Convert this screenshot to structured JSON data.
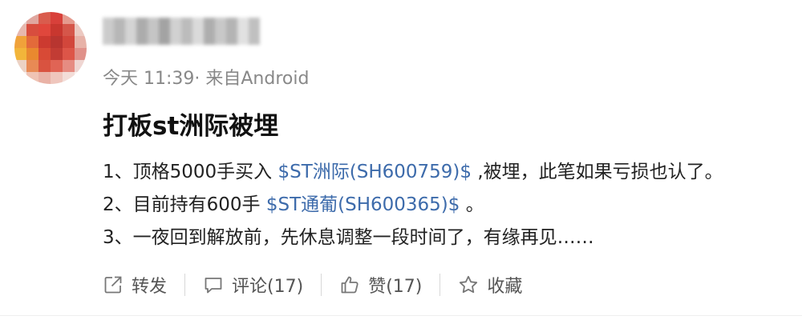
{
  "post": {
    "meta": "今天 11:39· 来自Android",
    "title": "打板st洲际被埋",
    "lines": [
      {
        "before": "1、顶格5000手买入 ",
        "stock": "$ST洲际(SH600759)$",
        "after": " ,被埋，此笔如果亏损也认了。"
      },
      {
        "before": "2、目前持有600手 ",
        "stock": "$ST通葡(SH600365)$",
        "after": " 。"
      },
      {
        "before": "3、一夜回到解放前，先休息调整一段时间了，有缘再见……",
        "stock": "",
        "after": ""
      }
    ]
  },
  "actions": {
    "repost": {
      "label": "转发",
      "icon": "share-icon"
    },
    "comment": {
      "label": "评论(17)",
      "icon": "comment-icon"
    },
    "like": {
      "label": "赞(17)",
      "icon": "thumbs-up-icon"
    },
    "favorite": {
      "label": "收藏",
      "icon": "star-icon"
    }
  },
  "colors": {
    "stock_link": "#3d6bab",
    "meta_text": "#888888",
    "action_text": "#555555"
  }
}
